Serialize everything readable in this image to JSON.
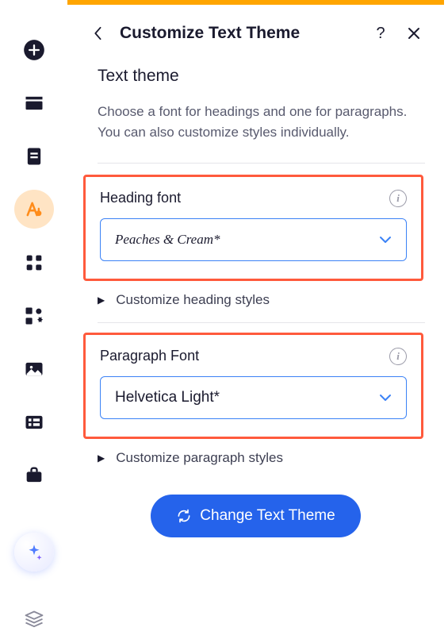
{
  "header": {
    "title": "Customize Text Theme"
  },
  "textTheme": {
    "title": "Text theme",
    "description": "Choose a font for headings and one for paragraphs. You can also customize styles individually."
  },
  "headingFont": {
    "label": "Heading font",
    "value": "Peaches & Cream*"
  },
  "paragraphFont": {
    "label": "Paragraph Font",
    "value": "Helvetica Light*"
  },
  "expand": {
    "heading": "Customize heading styles",
    "paragraph": "Customize paragraph styles"
  },
  "changeButton": {
    "label": "Change Text Theme"
  }
}
